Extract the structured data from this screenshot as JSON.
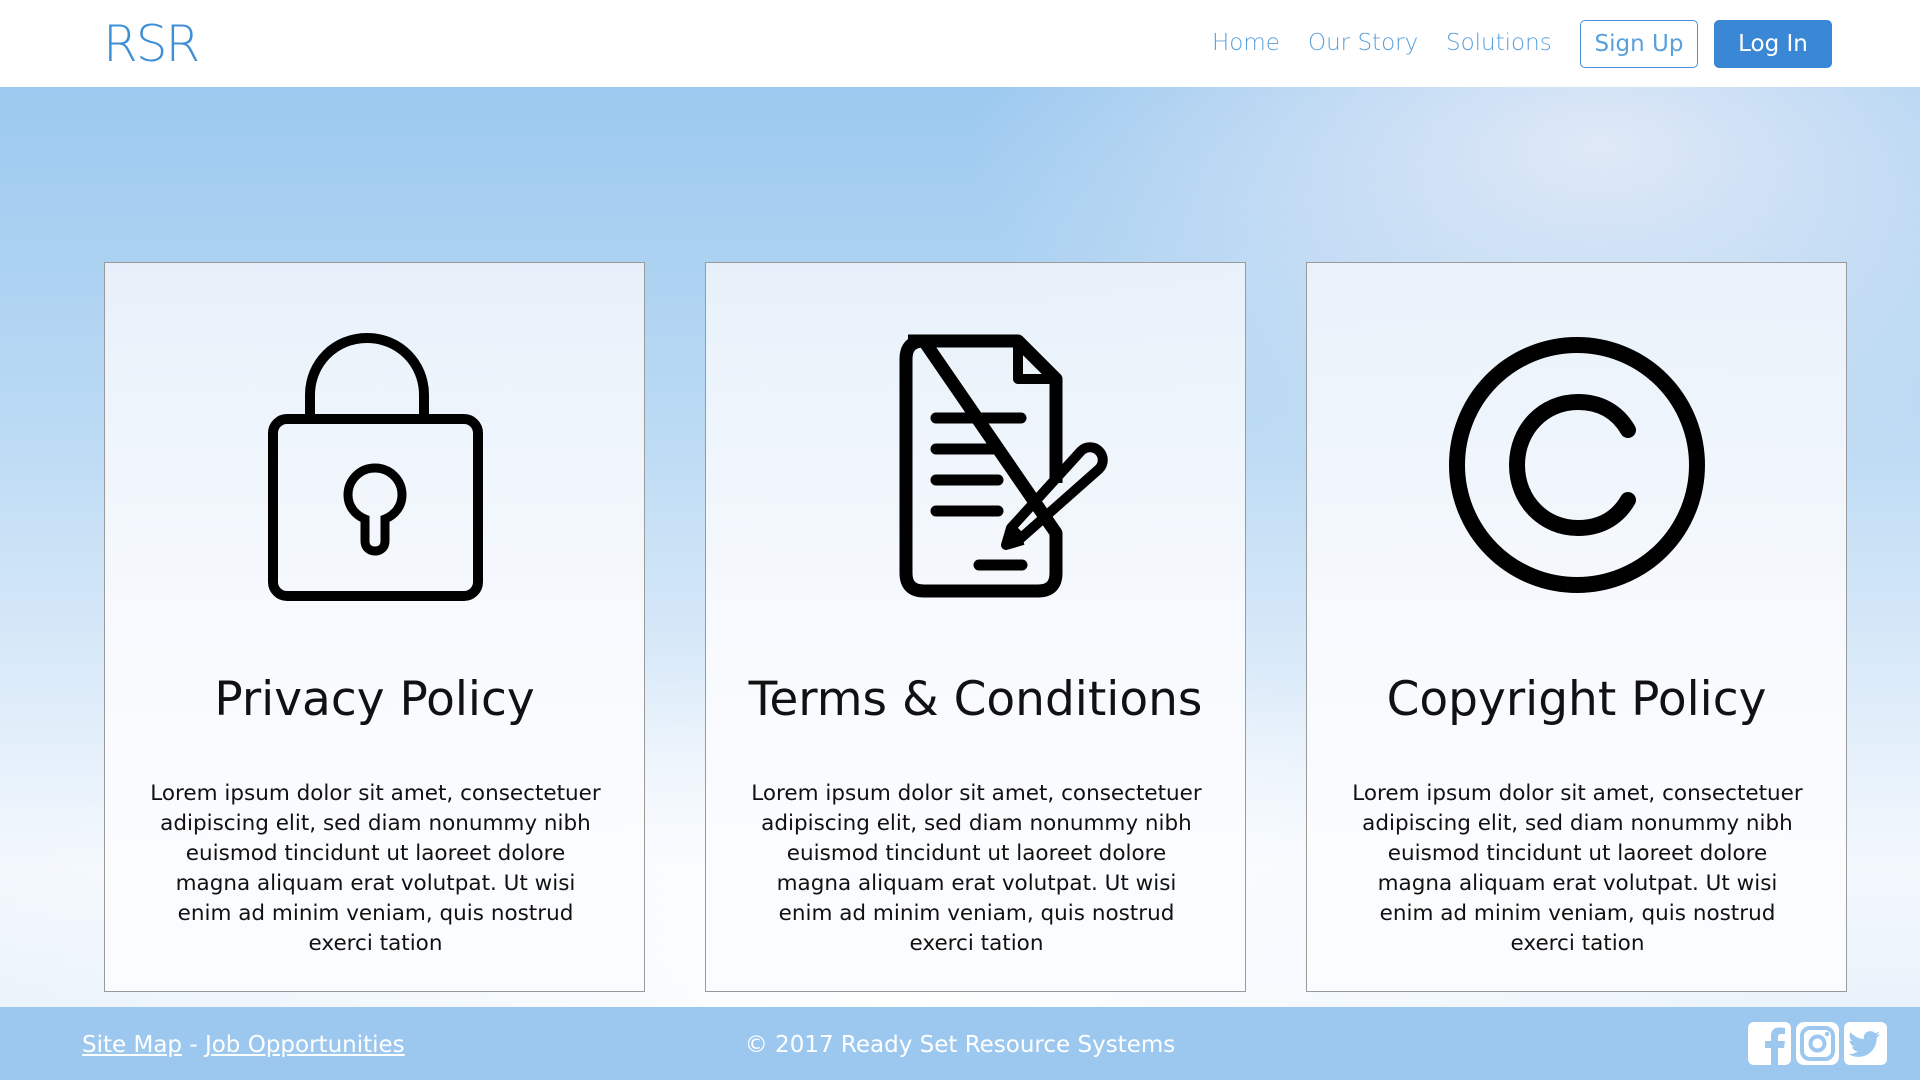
{
  "header": {
    "logo": "RSR",
    "nav": {
      "home": "Home",
      "our_story": "Our Story",
      "solutions": "Solutions"
    },
    "sign_up": "Sign Up",
    "log_in": "Log In"
  },
  "cards": [
    {
      "icon": "lock-icon",
      "title": "Privacy Policy",
      "text": "Lorem ipsum dolor sit amet, consectetuer adipiscing elit, sed diam nonummy nibh euismod tincidunt ut laoreet dolore magna aliquam erat volutpat. Ut wisi enim ad minim veniam, quis nostrud exerci tation"
    },
    {
      "icon": "document-pen-icon",
      "title": "Terms & Conditions",
      "text": "Lorem ipsum dolor sit amet, consectetuer adipiscing elit, sed diam nonummy nibh euismod tincidunt ut laoreet dolore magna aliquam erat volutpat. Ut wisi enim ad minim veniam, quis nostrud exerci tation"
    },
    {
      "icon": "copyright-icon",
      "title": "Copyright Policy",
      "text": "Lorem ipsum dolor sit amet, consectetuer adipiscing elit, sed diam nonummy nibh euismod tincidunt ut laoreet dolore magna aliquam erat volutpat. Ut wisi enim ad minim veniam, quis nostrud exerci tation"
    }
  ],
  "footer": {
    "site_map": "Site Map",
    "separator": "-",
    "job_opportunities": "Job Opportunities",
    "copyright": "© 2017 Ready Set Resource Systems",
    "social": [
      "facebook-icon",
      "instagram-icon",
      "twitter-icon"
    ]
  },
  "colors": {
    "accent": "#3a87d6",
    "footer_bg": "#9cc8ef"
  }
}
